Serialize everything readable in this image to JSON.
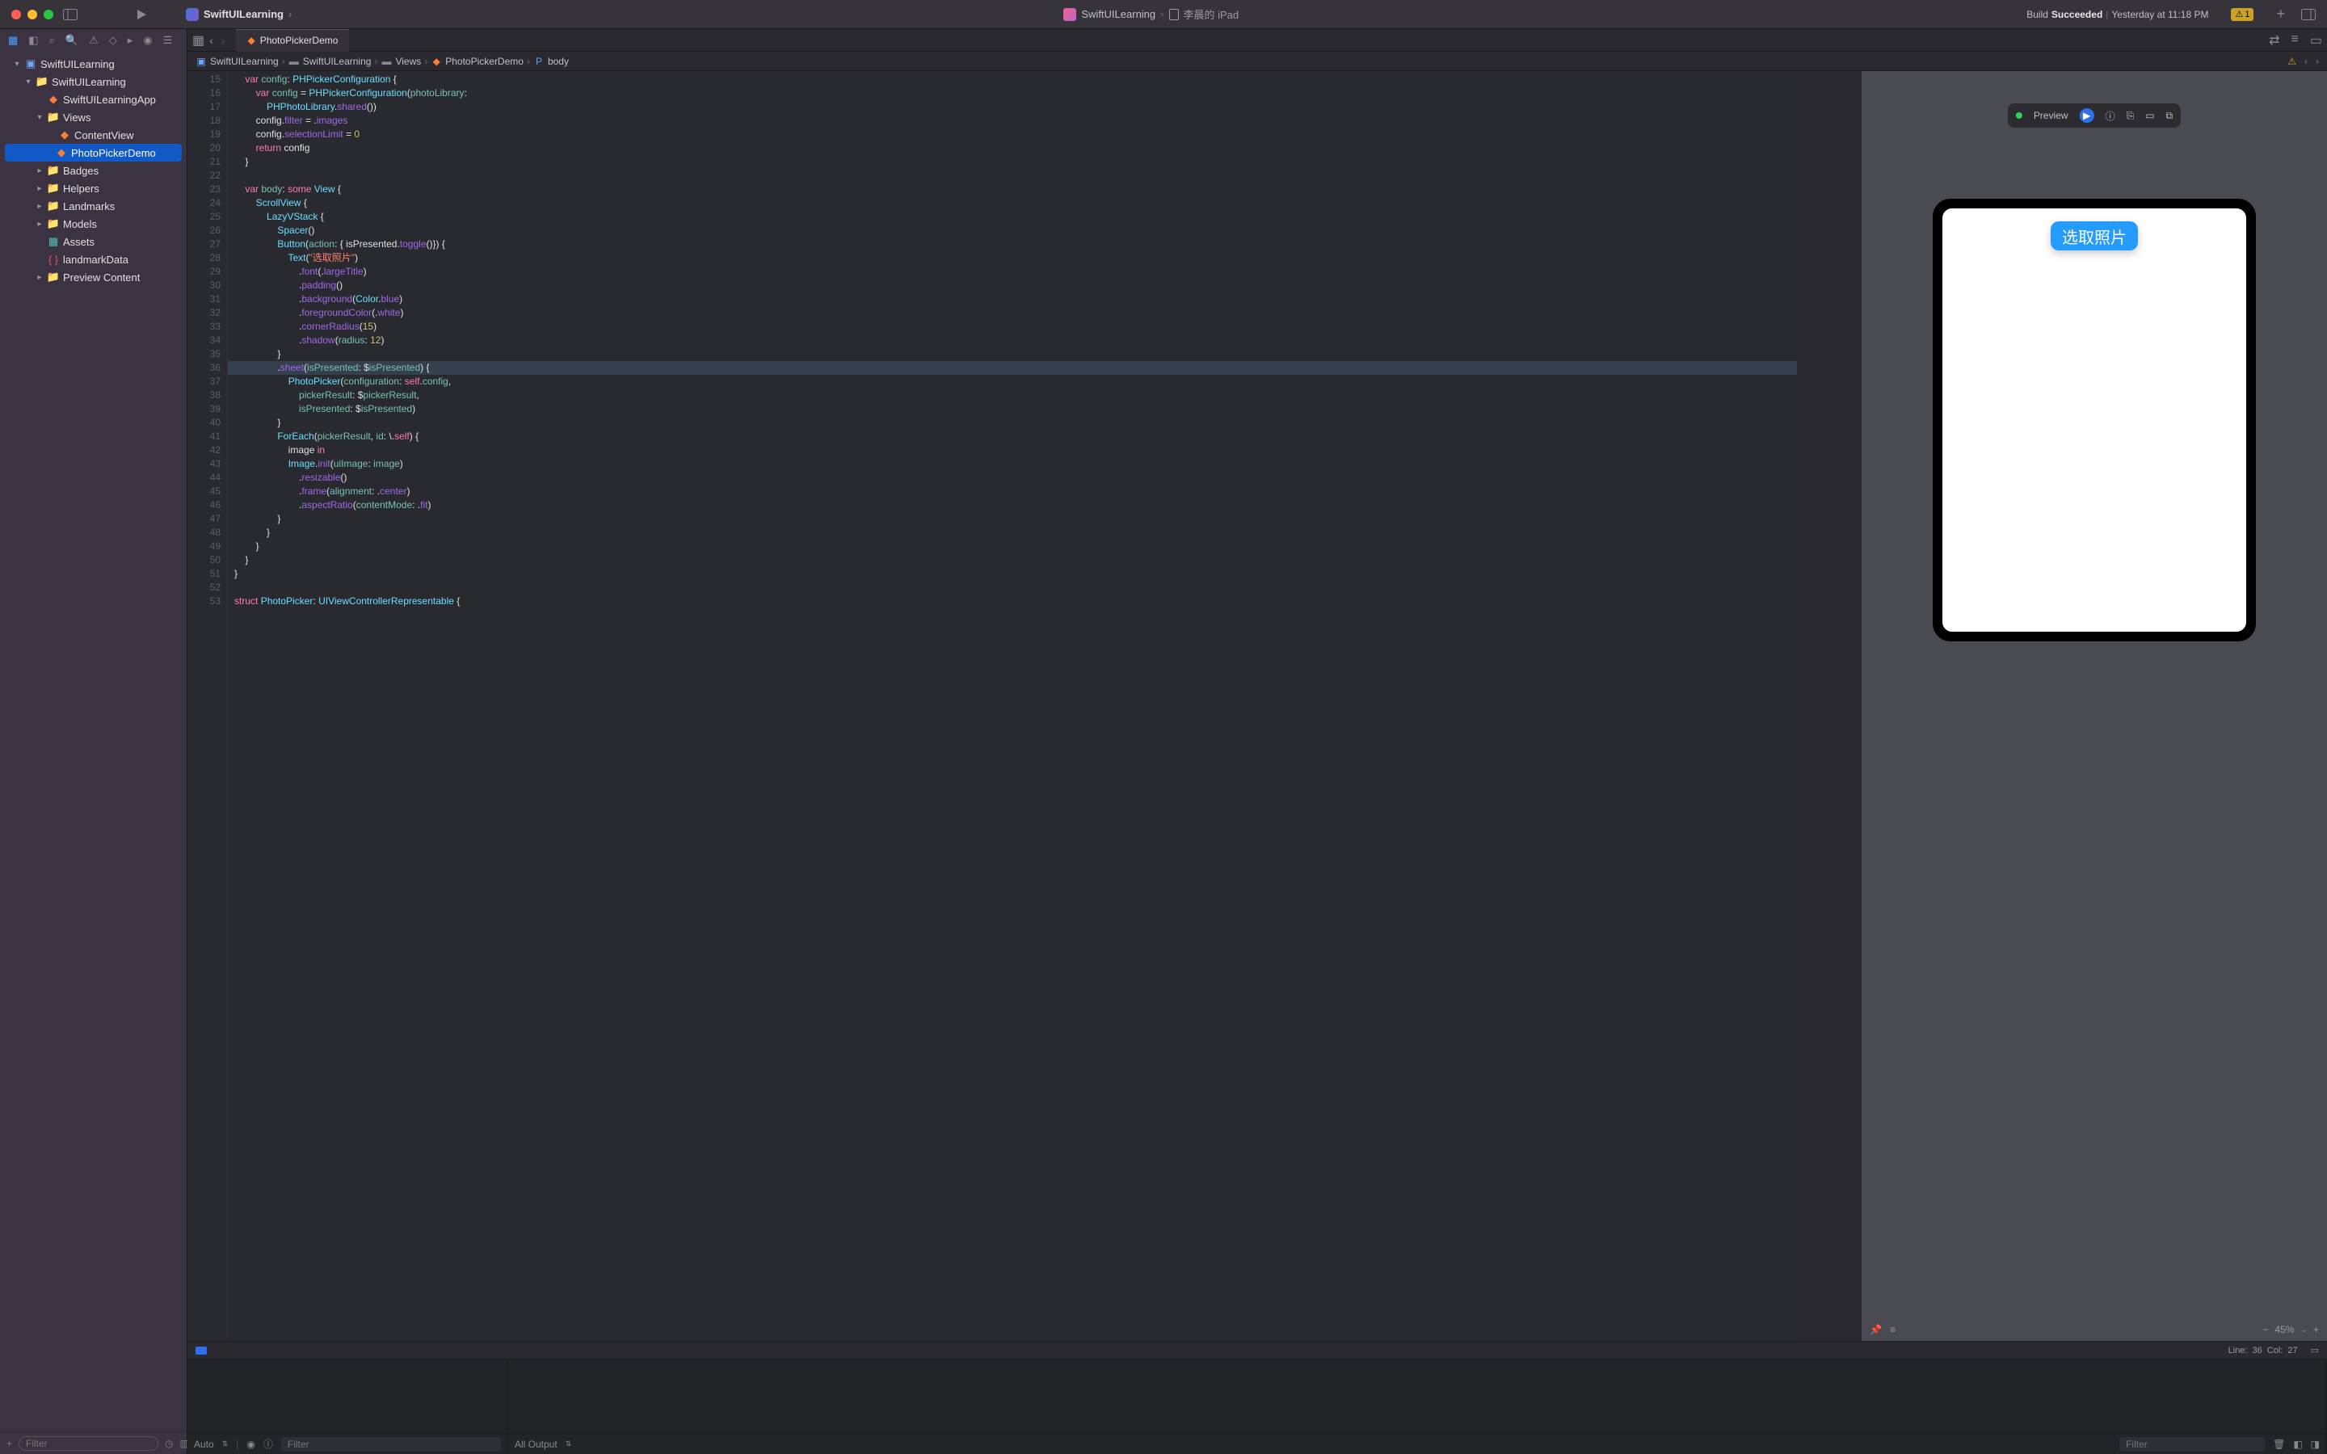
{
  "titlebar": {
    "project": "SwiftUILearning",
    "scheme": "SwiftUILearning",
    "device": "李晨的 iPad",
    "build_label": "Build",
    "succeeded": "Succeeded",
    "build_time": "Yesterday at 11:18 PM",
    "warning_count": "1"
  },
  "sidebar": {
    "filter_placeholder": "Filter",
    "tree": [
      {
        "indent": 0,
        "chev": "▾",
        "icon": "proj",
        "label": "SwiftUILearning"
      },
      {
        "indent": 1,
        "chev": "▾",
        "icon": "fold",
        "label": "SwiftUILearning"
      },
      {
        "indent": 2,
        "chev": "",
        "icon": "swift",
        "label": "SwiftUILearningApp"
      },
      {
        "indent": 2,
        "chev": "▾",
        "icon": "fold",
        "label": "Views"
      },
      {
        "indent": 3,
        "chev": "",
        "icon": "swift",
        "label": "ContentView"
      },
      {
        "indent": 3,
        "chev": "",
        "icon": "swift",
        "label": "PhotoPickerDemo",
        "selected": true
      },
      {
        "indent": 2,
        "chev": "▸",
        "icon": "fold",
        "label": "Badges"
      },
      {
        "indent": 2,
        "chev": "▸",
        "icon": "fold",
        "label": "Helpers"
      },
      {
        "indent": 2,
        "chev": "▸",
        "icon": "fold",
        "label": "Landmarks"
      },
      {
        "indent": 2,
        "chev": "▸",
        "icon": "fold",
        "label": "Models"
      },
      {
        "indent": 2,
        "chev": "",
        "icon": "asset",
        "label": "Assets"
      },
      {
        "indent": 2,
        "chev": "",
        "icon": "json",
        "label": "landmarkData"
      },
      {
        "indent": 2,
        "chev": "▸",
        "icon": "fold",
        "label": "Preview Content"
      }
    ]
  },
  "tab": {
    "label": "PhotoPickerDemo"
  },
  "jumpbar": {
    "items": [
      "SwiftUILearning",
      "SwiftUILearning",
      "Views",
      "PhotoPickerDemo",
      "body"
    ]
  },
  "editor": {
    "first_line": 15,
    "cursor": {
      "line": 36,
      "col": 27
    },
    "lines": [
      "    var config: PHPickerConfiguration {",
      "        var config = PHPickerConfiguration(photoLibrary:",
      "            PHPhotoLibrary.shared())",
      "        config.filter = .images",
      "        config.selectionLimit = 0",
      "        return config",
      "    }",
      "",
      "    var body: some View {",
      "        ScrollView {",
      "            LazyVStack {",
      "                Spacer()",
      "                Button(action: { isPresented.toggle()}) {",
      "                    Text(\"选取照片\")",
      "                        .font(.largeTitle)",
      "                        .padding()",
      "                        .background(Color.blue)",
      "                        .foregroundColor(.white)",
      "                        .cornerRadius(15)",
      "                        .shadow(radius: 12)",
      "                }",
      "                .sheet(isPresented: $isPresented) {",
      "                    PhotoPicker(configuration: self.config,",
      "                        pickerResult: $pickerResult,",
      "                        isPresented: $isPresented)",
      "                }",
      "                ForEach(pickerResult, id: \\.self) {",
      "                    image in",
      "                    Image.init(uiImage: image)",
      "                        .resizable()",
      "                        .frame(alignment: .center)",
      "                        .aspectRatio(contentMode: .fit)",
      "                }",
      "            }",
      "        }",
      "    }",
      "}",
      "",
      "struct PhotoPicker: UIViewControllerRepresentable {"
    ],
    "highlight_rows": [
      36
    ]
  },
  "canvas": {
    "preview_label": "Preview",
    "button_text": "选取照片",
    "zoom": "45%"
  },
  "status": {
    "line_label": "Line:",
    "line": "36",
    "col_label": "Col:",
    "col": "27"
  },
  "debug": {
    "auto": "Auto",
    "all_output": "All Output",
    "filter_placeholder": "Filter"
  }
}
